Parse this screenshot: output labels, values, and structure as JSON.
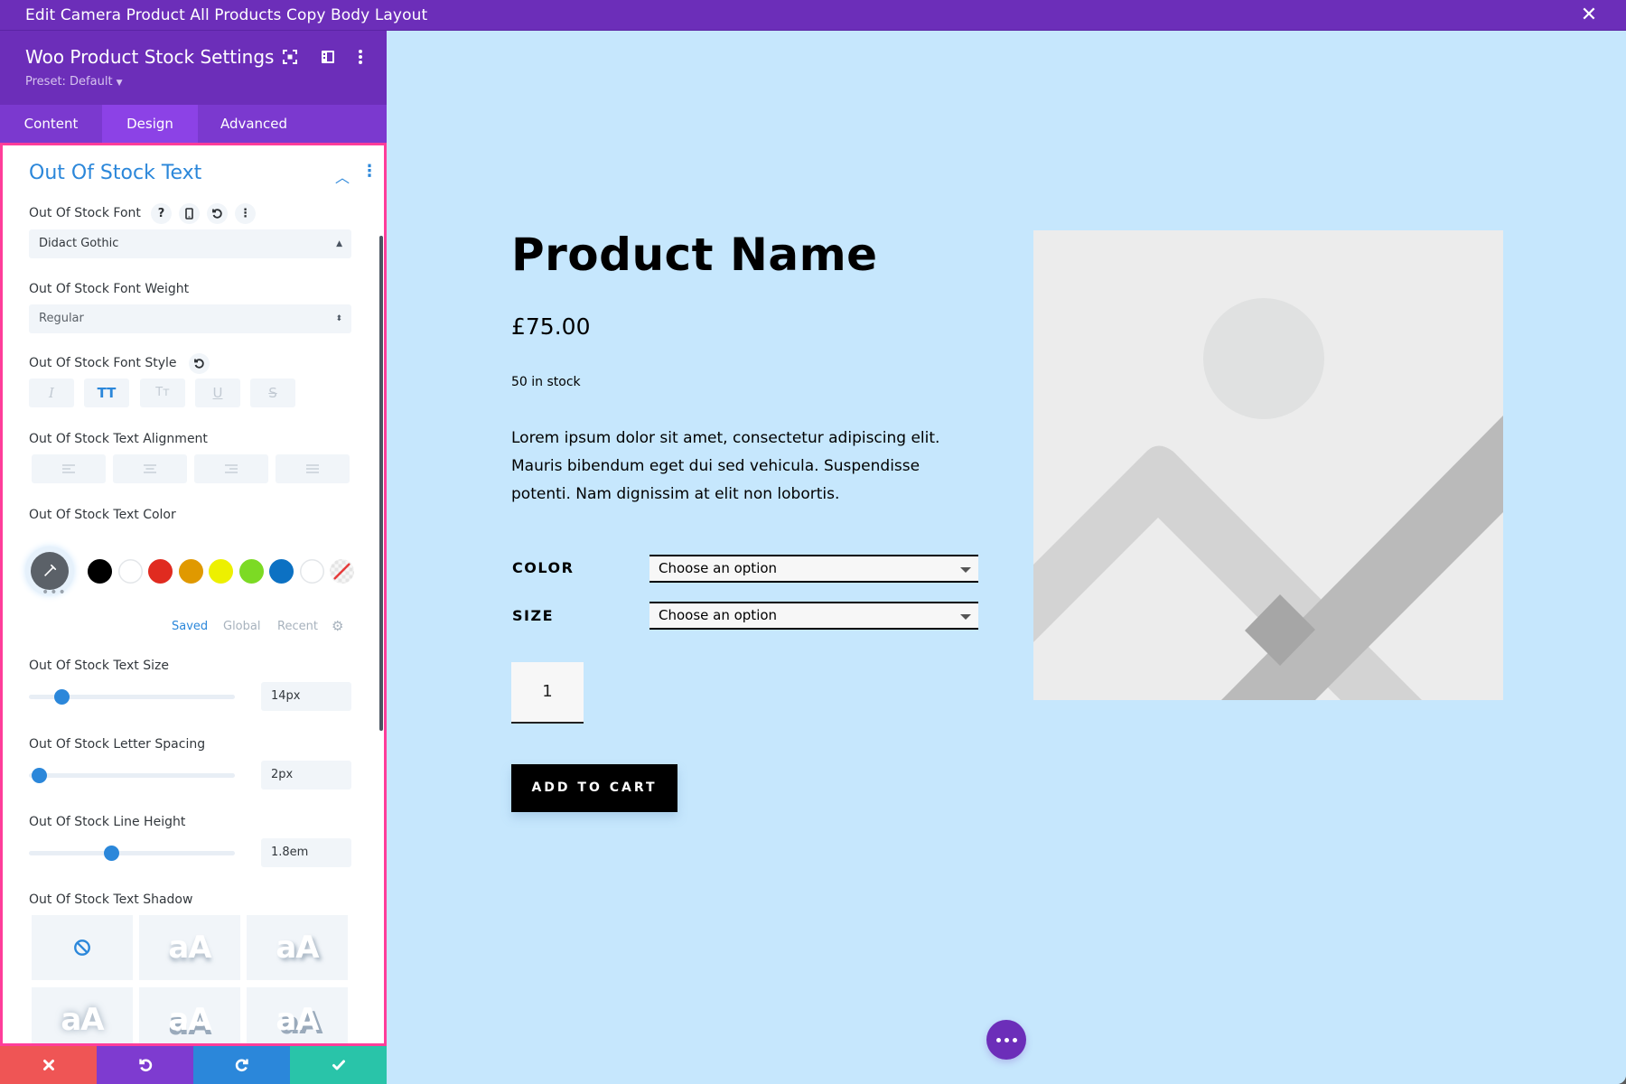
{
  "window": {
    "title": "Edit Camera Product All Products Copy Body Layout",
    "close_icon": "close-icon"
  },
  "sidebar": {
    "module_title": "Woo Product Stock Settings",
    "preset": "Preset: Default",
    "header_icons": [
      "fullscreen-icon",
      "split-view-icon",
      "more-vertical-icon"
    ],
    "tabs": [
      {
        "label": "Content",
        "active": false
      },
      {
        "label": "Design",
        "active": true
      },
      {
        "label": "Advanced",
        "active": false
      }
    ],
    "section": {
      "title": "Out Of Stock Text",
      "fields": {
        "font": {
          "label": "Out Of Stock Font",
          "value": "Didact Gothic",
          "icons": [
            "help-icon",
            "responsive-icon",
            "reset-icon",
            "more-icon"
          ]
        },
        "font_weight": {
          "label": "Out Of Stock Font Weight",
          "value": "Regular"
        },
        "font_style": {
          "label": "Out Of Stock Font Style",
          "options": [
            {
              "glyph": "I",
              "name": "italic",
              "active": false
            },
            {
              "glyph": "TT",
              "name": "uppercase",
              "active": true
            },
            {
              "glyph": "Tт",
              "name": "small-caps",
              "active": false
            },
            {
              "glyph": "U",
              "name": "underline",
              "active": false
            },
            {
              "glyph": "S",
              "name": "strikethrough",
              "active": false
            }
          ]
        },
        "text_alignment": {
          "label": "Out Of Stock Text Alignment",
          "options": [
            "left",
            "center",
            "right",
            "justify"
          ]
        },
        "text_color": {
          "label": "Out Of Stock Text Color",
          "swatches": [
            "#000000",
            "#ffffff",
            "#e02b20",
            "#e09900",
            "#edf000",
            "#7cda24",
            "#0c71c3",
            "#ffffff",
            "transparent"
          ],
          "more": "•••",
          "tabs": [
            {
              "label": "Saved",
              "active": true
            },
            {
              "label": "Global",
              "active": false
            },
            {
              "label": "Recent",
              "active": false
            }
          ]
        },
        "text_size": {
          "label": "Out Of Stock Text Size",
          "value": "14px",
          "slider_fraction": 0.16
        },
        "letter_spacing": {
          "label": "Out Of Stock Letter Spacing",
          "value": "2px",
          "slider_fraction": 0.05
        },
        "line_height": {
          "label": "Out Of Stock Line Height",
          "value": "1.8em",
          "slider_fraction": 0.4
        },
        "text_shadow": {
          "label": "Out Of Stock Text Shadow",
          "preview_text": "aA",
          "options": [
            "none",
            "shadow-1",
            "shadow-2",
            "shadow-3",
            "shadow-4",
            "shadow-5"
          ]
        }
      }
    },
    "footer": {
      "buttons": [
        {
          "name": "discard",
          "color": "#ef5555"
        },
        {
          "name": "undo",
          "color": "#7e3bd0"
        },
        {
          "name": "redo",
          "color": "#2b87da"
        },
        {
          "name": "save",
          "color": "#29c4a9"
        }
      ]
    }
  },
  "preview": {
    "product_name": "Product Name",
    "price": "£75.00",
    "stock": "50 in stock",
    "description": "Lorem ipsum dolor sit amet, consectetur adipiscing elit. Mauris bibendum eget dui sed vehicula. Suspendisse potenti. Nam dignissim at elit non lobortis.",
    "attributes": [
      {
        "label": "COLOR",
        "value": "Choose an option"
      },
      {
        "label": "SIZE",
        "value": "Choose an option"
      }
    ],
    "quantity": "1",
    "add_to_cart": "ADD TO CART",
    "image": "placeholder-image"
  },
  "colors": {
    "brand_purple": "#6c2eb9",
    "tab_active": "#8c42e6",
    "accent_blue": "#2b87da",
    "panel_border": "#ff3d9a",
    "canvas_bg": "#c6e7fd"
  }
}
